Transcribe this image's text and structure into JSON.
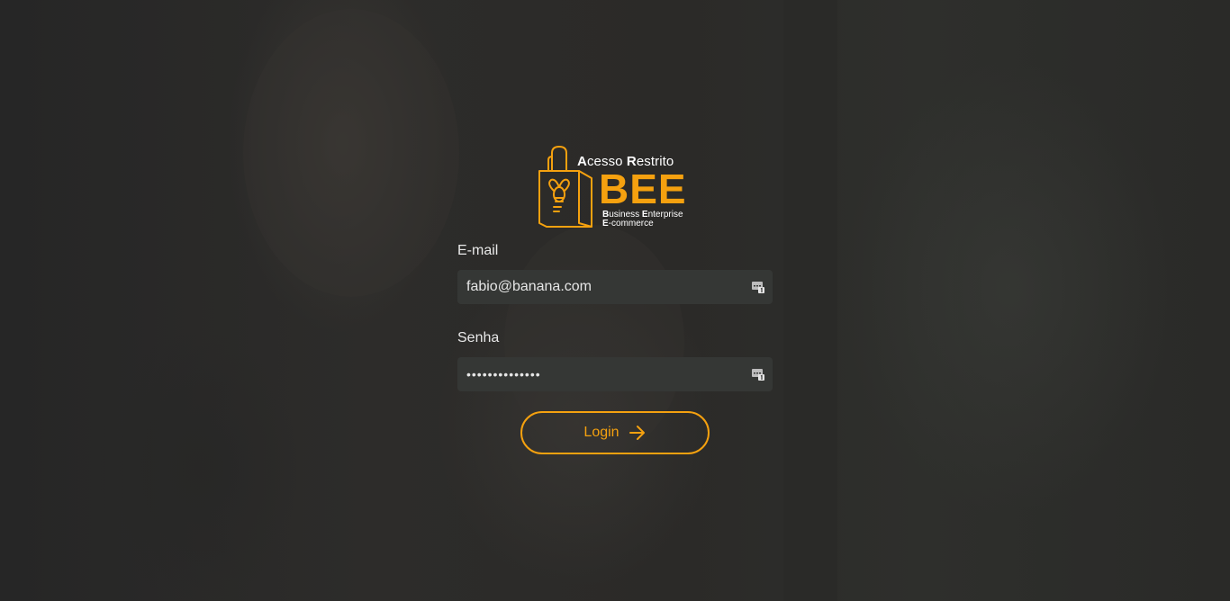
{
  "brand": {
    "title_prefix_bold_1": "A",
    "title_part_1": "cesso ",
    "title_prefix_bold_2": "R",
    "title_part_2": "estrito",
    "name": "BEE",
    "subtitle_line1_bold": "B",
    "subtitle_line1_a": "usiness ",
    "subtitle_line1_bold2": "E",
    "subtitle_line1_b": "nterprise",
    "subtitle_line2_bold": "E",
    "subtitle_line2_rest": "-commerce",
    "accent_color": "#f5a10f"
  },
  "form": {
    "email_label": "E-mail",
    "email_value": "fabio@banana.com",
    "password_label": "Senha",
    "password_value": "••••••••••••••",
    "login_label": "Login"
  },
  "icons": {
    "logo": "shopping-bag-bee-icon",
    "field_autofill": "password-manager-key-icon",
    "login_arrow": "arrow-right-icon"
  }
}
